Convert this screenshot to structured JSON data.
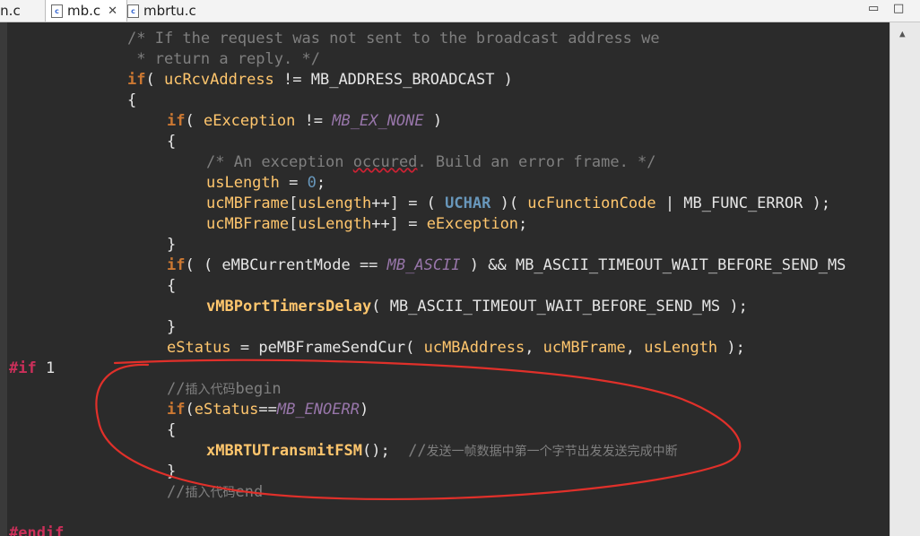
{
  "tabs": [
    {
      "name": "in.c",
      "active": false,
      "icon": "c-file-icon"
    },
    {
      "name": "mb.c",
      "active": true,
      "icon": "c-file-icon"
    },
    {
      "name": "mbrtu.c",
      "active": false,
      "icon": "c-file-icon"
    }
  ],
  "close_glyph": "✕",
  "window_controls": {
    "minimize": "▭",
    "maximize": "□"
  },
  "code": {
    "l1": "/* If the request was not sent to the broadcast address we",
    "l2": " * return a reply. */",
    "l3a": "if",
    "l3b": "( ",
    "l3c": "ucRcvAddress",
    "l3d": " != MB_ADDRESS_BROADCAST )",
    "l4": "{",
    "l5a": "if",
    "l5b": "( ",
    "l5c": "eException",
    "l5d": " != ",
    "l5e": "MB_EX_NONE",
    "l5f": " )",
    "l6": "{",
    "l7a": "/* An exception ",
    "l7b": "occured",
    "l7c": ". Build an error frame. */",
    "l8a": "usLength",
    "l8b": " = ",
    "l8c": "0",
    "l8d": ";",
    "l9a": "ucMBFrame",
    "l9b": "[",
    "l9c": "usLength",
    "l9d": "++] = ( ",
    "l9e": "UCHAR",
    "l9f": " )( ",
    "l9g": "ucFunctionCode",
    "l9h": " | MB_FUNC_ERROR );",
    "l10a": "ucMBFrame",
    "l10b": "[",
    "l10c": "usLength",
    "l10d": "++] = ",
    "l10e": "eException",
    "l10f": ";",
    "l11": "}",
    "l12a": "if",
    "l12b": "( ( eMBCurrentMode == ",
    "l12c": "MB_ASCII",
    "l12d": " ) && MB_ASCII_TIMEOUT_WAIT_BEFORE_SEND_MS",
    "l13": "{",
    "l14a": "vMBPortTimersDelay",
    "l14b": "( MB_ASCII_TIMEOUT_WAIT_BEFORE_SEND_MS );",
    "l15": "}",
    "l16a": "eStatus",
    "l16b": " = peMBFrameSendCur( ",
    "l16c": "ucMBAddress",
    "l16d": ", ",
    "l16e": "ucMBFrame",
    "l16f": ", ",
    "l16g": "usLength",
    "l16h": " );",
    "l17a": "#if",
    "l17b": " 1",
    "l18a": "//",
    "l18b": "插入代码",
    "l18c": "begin",
    "l19a": "if",
    "l19b": "(",
    "l19c": "eStatus",
    "l19d": "==",
    "l19e": "MB_ENOERR",
    "l19f": ")",
    "l20": "{",
    "l21a": "xMBRTUTransmitFSM",
    "l21b": "();  ",
    "l21c": "//",
    "l21d": "发送一帧数据中第一个字节出发发送完成中断",
    "l22": "}",
    "l23a": "//",
    "l23b": "插入代码",
    "l23c": "end",
    "l24": "#endif"
  },
  "colors": {
    "annotation": "#e0302a"
  }
}
